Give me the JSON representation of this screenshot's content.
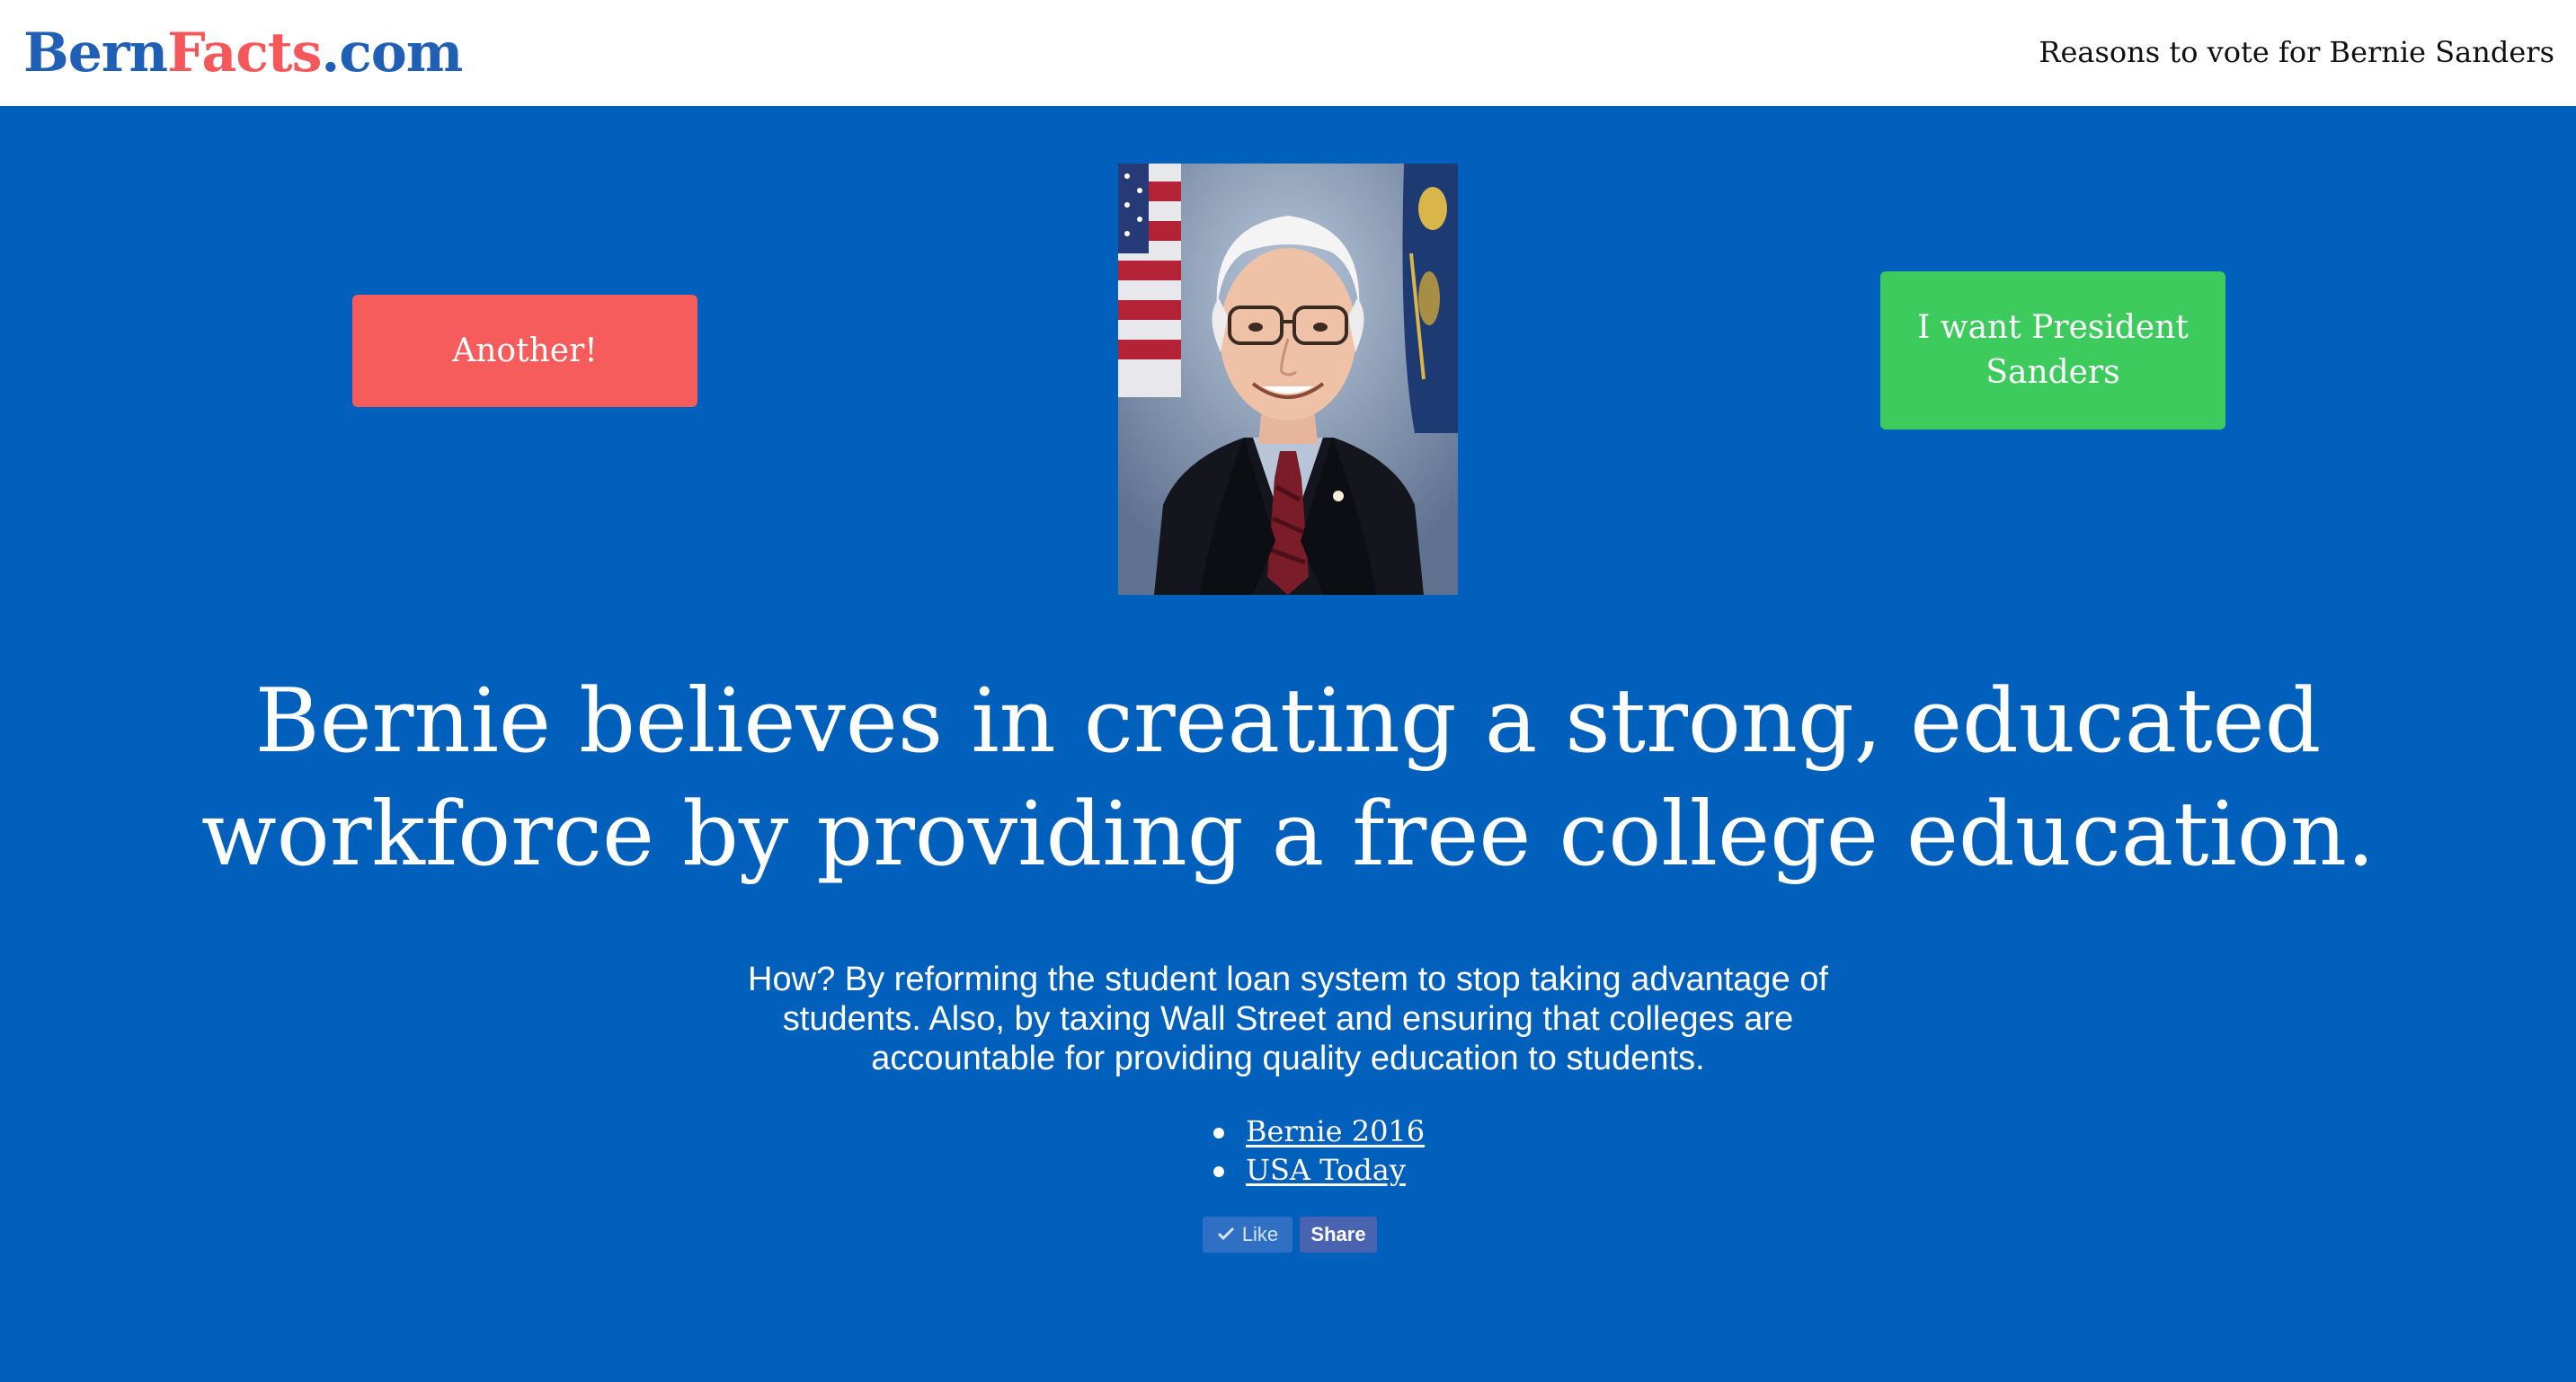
{
  "header": {
    "logo": {
      "part_a": "Bern",
      "part_b": "Facts",
      "part_c": ".com"
    },
    "tagline": "Reasons to vote for Bernie Sanders"
  },
  "hero": {
    "another_button": "Another!",
    "president_button": "I want President Sanders",
    "headline": "Bernie believes in creating a strong, educated workforce by providing a free college education.",
    "explainer": "How? By reforming the student loan system to stop taking advantage of students. Also, by taxing Wall Street and ensuring that colleges are accountable for providing quality education to students.",
    "sources": [
      {
        "label": "Bernie 2016"
      },
      {
        "label": "USA Today"
      }
    ],
    "social": {
      "like_label": "Like",
      "share_label": "Share"
    }
  },
  "colors": {
    "hero_background": "#0060BB",
    "logo_blue": "#1F5FB6",
    "logo_red": "#F4585A",
    "another_button": "#F65C5C",
    "president_button": "#3DCB5E"
  },
  "icons": {
    "like": "check-icon"
  }
}
